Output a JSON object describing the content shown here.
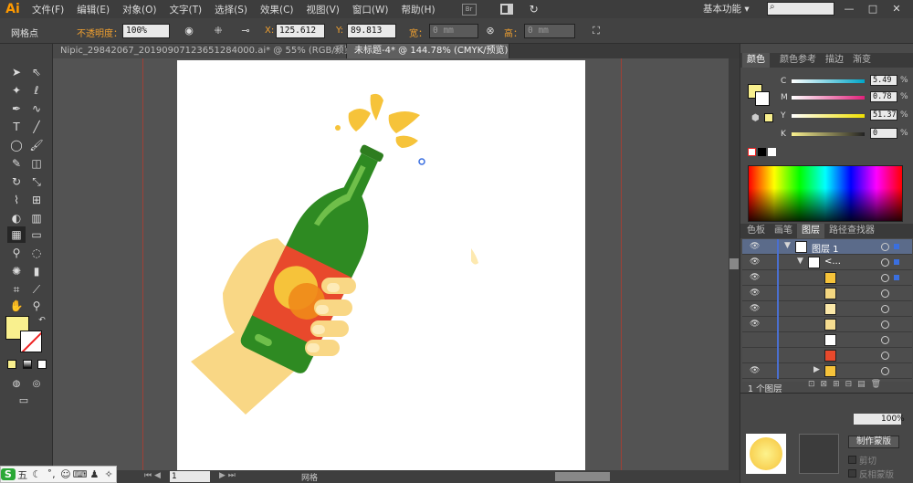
{
  "app": {
    "logo": "Ai"
  },
  "menu": [
    "文件(F)",
    "编辑(E)",
    "对象(O)",
    "文字(T)",
    "选择(S)",
    "效果(C)",
    "视图(V)",
    "窗口(W)",
    "帮助(H)"
  ],
  "menu_icons": [
    "bridge-icon",
    "arrange-documents-icon",
    "gpu-preview-icon"
  ],
  "workspace": "基本功能",
  "window_controls": {
    "minimize": "—",
    "maximize": "□",
    "close": "✕"
  },
  "control_bar": {
    "tool_name": "网格点",
    "opacity_label": "不透明度：",
    "opacity_value": "100%",
    "x_label": "X:",
    "x_value": "125.612",
    "y_label": "Y:",
    "y_value": "89.813",
    "width_label": "宽：",
    "width_value": "0 mm",
    "height_label": "高：",
    "height_value": "0 mm"
  },
  "tabs": [
    {
      "label": "Nipic_29842067_20190907123651284000.ai* @ 55% (RGB/预览)",
      "active": false
    },
    {
      "label": "未标题-4* @ 144.78% (CMYK/预览)",
      "active": true
    }
  ],
  "color_panel": {
    "tabs": [
      "颜色",
      "颜色参考",
      "描边",
      "渐变"
    ],
    "channels": [
      {
        "name": "C",
        "value": "5.49",
        "color": "#00a6c8"
      },
      {
        "name": "M",
        "value": "0.78",
        "color": "#e0207a"
      },
      {
        "name": "Y",
        "value": "51.37",
        "color": "#f0e000"
      },
      {
        "name": "K",
        "value": "0",
        "color": "#222222"
      }
    ],
    "percent": "%",
    "fill_color": "#f9f08e"
  },
  "layers_panel": {
    "tabs": [
      "色板",
      "画笔",
      "图层",
      "路径查找器"
    ],
    "layer_name": "图层 1",
    "group_name": "<...",
    "footer_count": "1 个图层"
  },
  "transparency_panel": {
    "opacity": "100%",
    "make_mask": "制作蒙版",
    "clip": "剪切",
    "invert_mask": "反相蒙版"
  },
  "status": {
    "zoom": "1",
    "mode": "网格"
  },
  "ime": {
    "label": "五"
  }
}
